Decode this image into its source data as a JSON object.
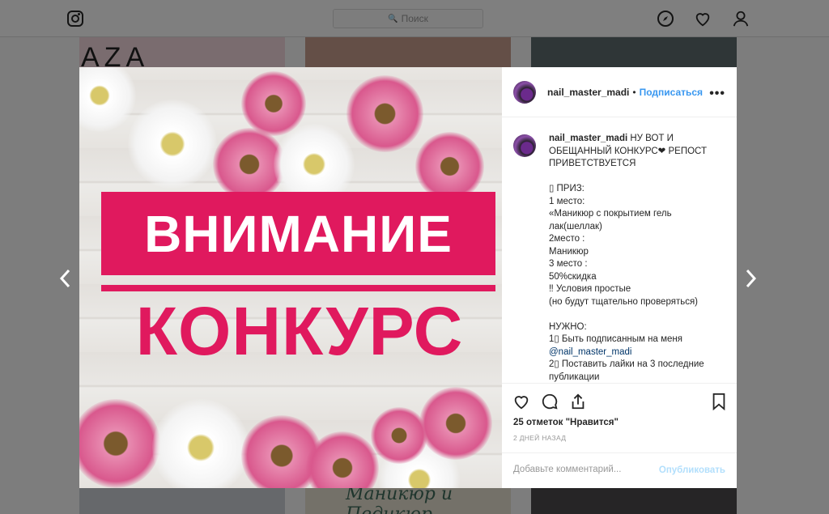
{
  "topbar": {
    "search_placeholder": "Поиск"
  },
  "background": {
    "tile_text_top_left": "AZA",
    "tile_text_bottom_middle": "Маникюр и Педикюр"
  },
  "post": {
    "image": {
      "banner_text": "ВНИМАНИЕ",
      "secondary_text": "КОНКУРС"
    },
    "header": {
      "username": "nail_master_madi",
      "separator": "•",
      "follow_label": "Подписаться",
      "more_glyph": "•••"
    },
    "caption": {
      "username": "nail_master_madi",
      "lines": [
        "НУ ВОТ И",
        "ОБЕЩАННЫЙ КОНКУРС❤ РЕПОСТ",
        "ПРИВЕТСТВУЕТСЯ",
        "",
        "▯ ПРИЗ:",
        "1 место:",
        "«Маникюр с покрытием гель",
        "лак(шеллак)",
        "2место :",
        "Маникюр",
        "3 место :",
        "50%скидка",
        "‼ Условия простые",
        "(но будут тщательно проверяться)",
        "",
        "НУЖНО:",
        "1▯ Быть подписанным на меня",
        "@nail_master_madi",
        "2▯ Поставить лайки на 3 последние",
        "публикации"
      ]
    },
    "likes_text": "25 отметок \"Нравится\"",
    "time_text": "2 ДНЕЙ НАЗАД",
    "comment_placeholder": "Добавьте комментарий...",
    "publish_label": "Опубликовать"
  },
  "colors": {
    "accent_blue": "#3897f0",
    "banner_pink": "#e0195e",
    "publish_disabled": "#b2dffc"
  }
}
